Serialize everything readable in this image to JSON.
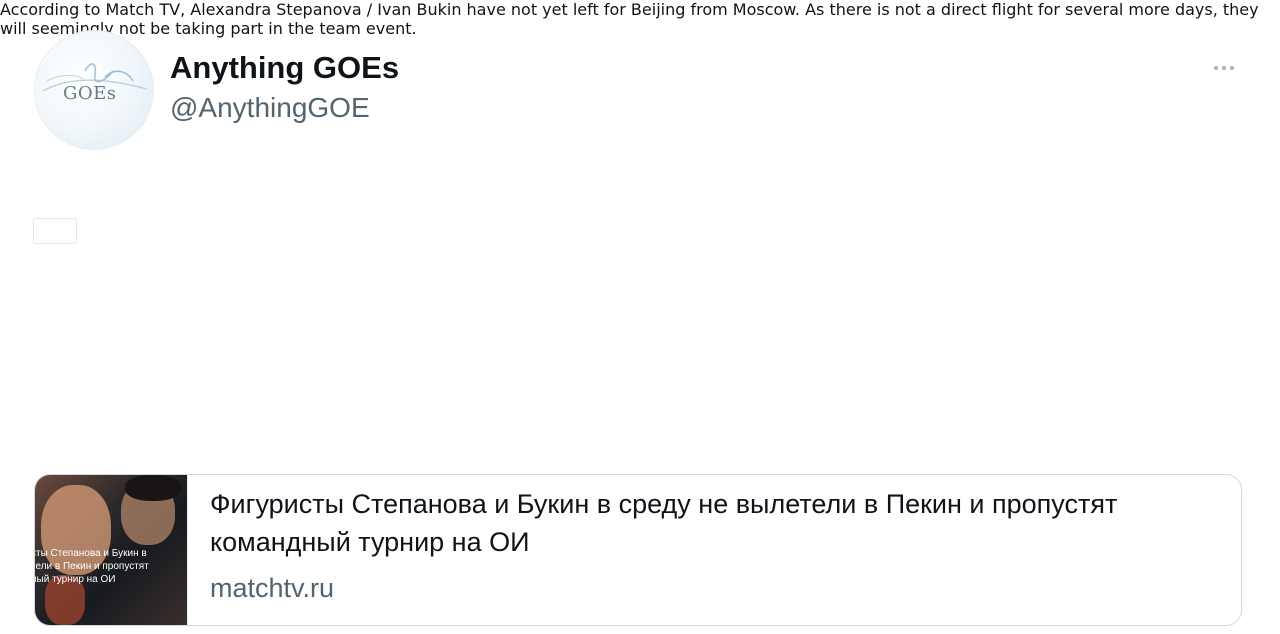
{
  "author": {
    "name": "Anything GOEs",
    "handle": "@AnythingGOE",
    "avatar_text": "GOEs",
    "avatar_script": "anything"
  },
  "header": {
    "more_icon": "more-horizontal-icon"
  },
  "tweet": {
    "flag_icon": "russia-flag-icon",
    "flag_colors": [
      "#ffffff",
      "#1c57d1",
      "#d52b1e"
    ],
    "text": "According to Match TV, Alexandra Stepanova / Ivan Bukin have not yet left for Beijing from Moscow. As there is not a direct flight for several more days, they will seemingly not be taking part in the team event."
  },
  "card": {
    "title": "Фигуристы Степанова и Букин в среду не вылетели в Пекин и пропустят командный турнир на ОИ",
    "domain": "matchtv.ru",
    "thumbnail_caption_lines": [
      "сты Степанова и Букин в",
      "тели в Пекин и пропустят",
      "ный турнир на ОИ"
    ]
  }
}
